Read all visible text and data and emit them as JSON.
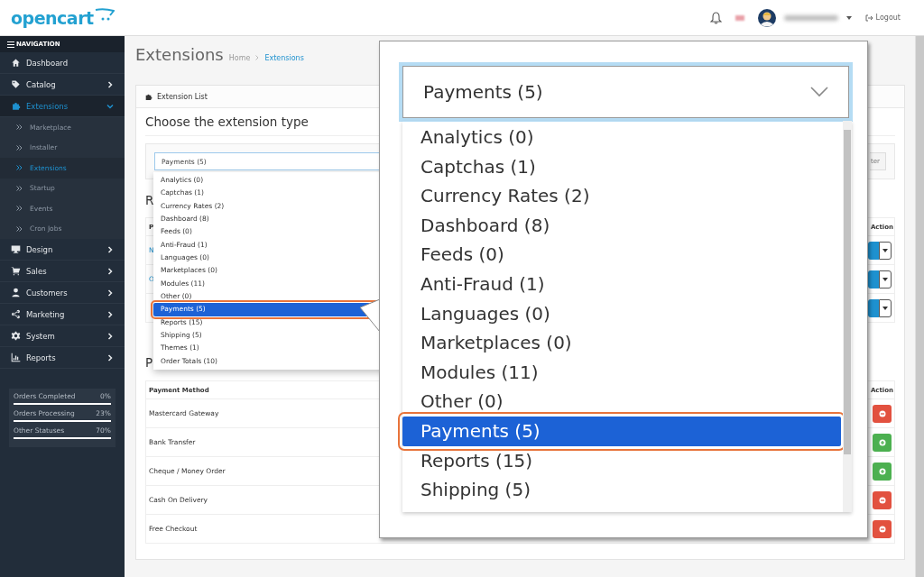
{
  "header": {
    "logo": "opencart",
    "logout": "Logout"
  },
  "navigation": {
    "title": "NAVIGATION",
    "items": [
      {
        "label": "Dashboard",
        "selected": false
      },
      {
        "label": "Catalog",
        "selected": false,
        "expanded": false
      },
      {
        "label": "Extensions",
        "selected": true,
        "expanded": true,
        "children": [
          {
            "label": "Marketplace",
            "selected": false
          },
          {
            "label": "Installer",
            "selected": false
          },
          {
            "label": "Extensions",
            "selected": true
          },
          {
            "label": "Startup",
            "selected": false
          },
          {
            "label": "Events",
            "selected": false
          },
          {
            "label": "Cron Jobs",
            "selected": false
          }
        ]
      },
      {
        "label": "Design",
        "selected": false,
        "expanded": false
      },
      {
        "label": "Sales",
        "selected": false,
        "expanded": false
      },
      {
        "label": "Customers",
        "selected": false,
        "expanded": false
      },
      {
        "label": "Marketing",
        "selected": false,
        "expanded": false
      },
      {
        "label": "System",
        "selected": false,
        "expanded": false
      },
      {
        "label": "Reports",
        "selected": false,
        "expanded": false
      }
    ]
  },
  "stats": [
    {
      "label": "Orders Completed",
      "value": "0%"
    },
    {
      "label": "Orders Processing",
      "value": "23%"
    },
    {
      "label": "Other Statuses",
      "value": "70%"
    }
  ],
  "page": {
    "title": "Extensions",
    "breadcrumb": [
      {
        "label": "Home",
        "selected": false
      },
      {
        "label": "Extensions",
        "selected": true
      }
    ]
  },
  "panel": {
    "heading": "Extension List",
    "section_title": "Choose the extension type",
    "select_value": "Payments (5)",
    "filter_button": "ter",
    "options": [
      {
        "label": "Analytics (0)",
        "selected": false
      },
      {
        "label": "Captchas (1)",
        "selected": false
      },
      {
        "label": "Currency Rates (2)",
        "selected": false
      },
      {
        "label": "Dashboard (8)",
        "selected": false
      },
      {
        "label": "Feeds (0)",
        "selected": false
      },
      {
        "label": "Anti-Fraud (1)",
        "selected": false
      },
      {
        "label": "Languages (0)",
        "selected": false
      },
      {
        "label": "Marketplaces (0)",
        "selected": false
      },
      {
        "label": "Modules (11)",
        "selected": false
      },
      {
        "label": "Other (0)",
        "selected": false
      },
      {
        "label": "Payments (5)",
        "selected": true
      },
      {
        "label": "Reports (15)",
        "selected": false
      },
      {
        "label": "Shipping (5)",
        "selected": false
      },
      {
        "label": "Themes (1)",
        "selected": false
      },
      {
        "label": "Order Totals (10)",
        "selected": false
      }
    ]
  },
  "recommended": {
    "heading": "R",
    "columns": [
      "P",
      "Action"
    ],
    "rows": [
      {
        "name": "N",
        "kind": "module"
      },
      {
        "name": "O",
        "kind": "module"
      },
      {
        "kind": "module"
      }
    ]
  },
  "payments": {
    "heading": "P",
    "columns": [
      "Payment Method",
      "Action"
    ],
    "rows": [
      {
        "name": "Mastercard Gateway",
        "installed": true
      },
      {
        "name": "Bank Transfer",
        "installed": false
      },
      {
        "name": "Cheque / Money Order",
        "installed": false
      },
      {
        "name": "Cash On Delivery",
        "installed": true
      },
      {
        "name": "Free Checkout",
        "installed": true
      }
    ]
  },
  "callout": {
    "select_value": "Payments (5)",
    "options": [
      {
        "label": "Analytics (0)",
        "selected": false
      },
      {
        "label": "Captchas (1)",
        "selected": false
      },
      {
        "label": "Currency Rates (2)",
        "selected": false
      },
      {
        "label": "Dashboard (8)",
        "selected": false
      },
      {
        "label": "Feeds (0)",
        "selected": false
      },
      {
        "label": "Anti-Fraud (1)",
        "selected": false
      },
      {
        "label": "Languages (0)",
        "selected": false
      },
      {
        "label": "Marketplaces (0)",
        "selected": false
      },
      {
        "label": "Modules (11)",
        "selected": false
      },
      {
        "label": "Other (0)",
        "selected": false
      },
      {
        "label": "Payments (5)",
        "selected": true
      },
      {
        "label": "Reports (15)",
        "selected": false
      },
      {
        "label": "Shipping (5)",
        "selected": false
      }
    ]
  }
}
